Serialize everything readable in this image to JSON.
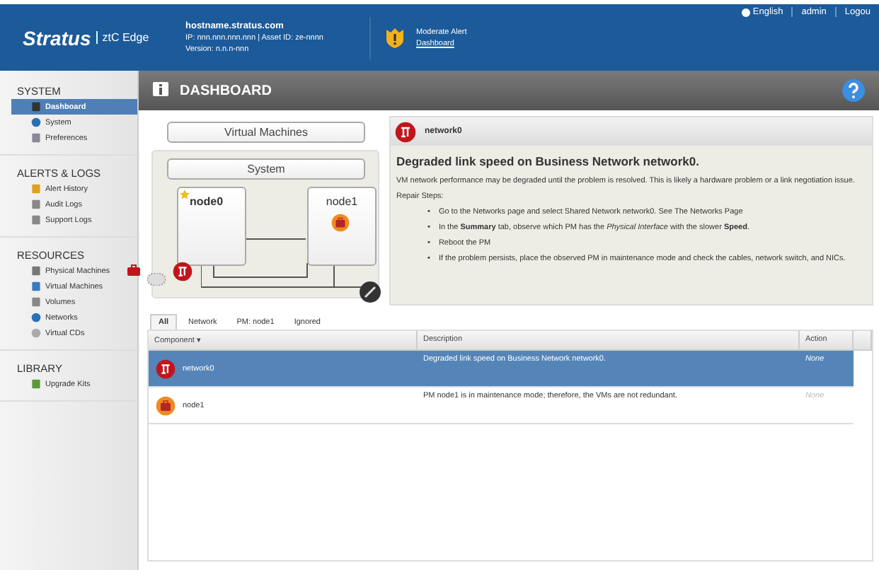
{
  "header": {
    "logo": "Stratus",
    "product": "ztC Edge",
    "hostname": "hostname.stratus.com",
    "ip_line": "IP: nnn.nnn.nnn.nnn | Asset ID: ze-nnnn",
    "version": "Version: n.n.n-nnn",
    "alert_title": "Moderate Alert",
    "alert_link": "Dashboard",
    "top_links": [
      "English",
      "admin",
      "Logou"
    ]
  },
  "sidebar": [
    {
      "title": "SYSTEM",
      "items": [
        {
          "label": "Dashboard",
          "selected": true,
          "badge": false
        },
        {
          "label": "System",
          "selected": false,
          "badge": false
        },
        {
          "label": "Preferences",
          "selected": false,
          "badge": false
        }
      ]
    },
    {
      "title": "ALERTS & LOGS",
      "items": [
        {
          "label": "Alert History",
          "selected": false,
          "badge": false
        },
        {
          "label": "Audit Logs",
          "selected": false,
          "badge": false
        },
        {
          "label": "Support Logs",
          "selected": false,
          "badge": false
        }
      ]
    },
    {
      "title": "RESOURCES",
      "items": [
        {
          "label": "Physical Machines",
          "selected": false,
          "badge": true
        },
        {
          "label": "Virtual Machines",
          "selected": false,
          "badge": false
        },
        {
          "label": "Volumes",
          "selected": false,
          "badge": false
        },
        {
          "label": "Networks",
          "selected": false,
          "badge": false
        },
        {
          "label": "Virtual CDs",
          "selected": false,
          "badge": false
        }
      ]
    },
    {
      "title": "LIBRARY",
      "items": [
        {
          "label": "Upgrade Kits",
          "selected": false,
          "badge": false
        }
      ]
    }
  ],
  "page_title": "DASHBOARD",
  "topology": {
    "vm_label": "Virtual Machines",
    "system_label": "System",
    "nodes": [
      {
        "name": "node0",
        "primary": true,
        "maintenance": false
      },
      {
        "name": "node1",
        "primary": false,
        "maintenance": true
      }
    ]
  },
  "detail": {
    "component": "network0",
    "heading": "Degraded link speed on Business Network network0.",
    "summary": "VM network performance may be degraded until the problem is resolved. This is likely a hardware problem or a link negotiation issue.",
    "steps_label": "Repair Steps:",
    "step_marker": "•",
    "steps": [
      "Go to the Networks page and select Shared Network network0. See The Networks Page",
      "In the **Summary** tab, observe which PM has the *Physical Interface* with the slower **Speed**.",
      "Reboot the PM",
      "If the problem persists, place the observed PM in maintenance mode and check the cables, network switch, and NICs."
    ]
  },
  "tabs": [
    {
      "label": "All",
      "selected": true
    },
    {
      "label": "Network",
      "selected": false
    },
    {
      "label": "PM: node1",
      "selected": false
    },
    {
      "label": "Ignored",
      "selected": false
    }
  ],
  "table": {
    "columns": [
      "Component ▾",
      "Description",
      "Action"
    ],
    "rows": [
      {
        "kind": "network",
        "component": "network0",
        "description": "Degraded link speed on Business Network network0.",
        "action": "None",
        "selected": true
      },
      {
        "kind": "maintenance",
        "component": "node1",
        "description": "PM node1 is in maintenance mode; therefore, the VMs are not redundant.",
        "action": "None",
        "selected": false
      }
    ]
  }
}
